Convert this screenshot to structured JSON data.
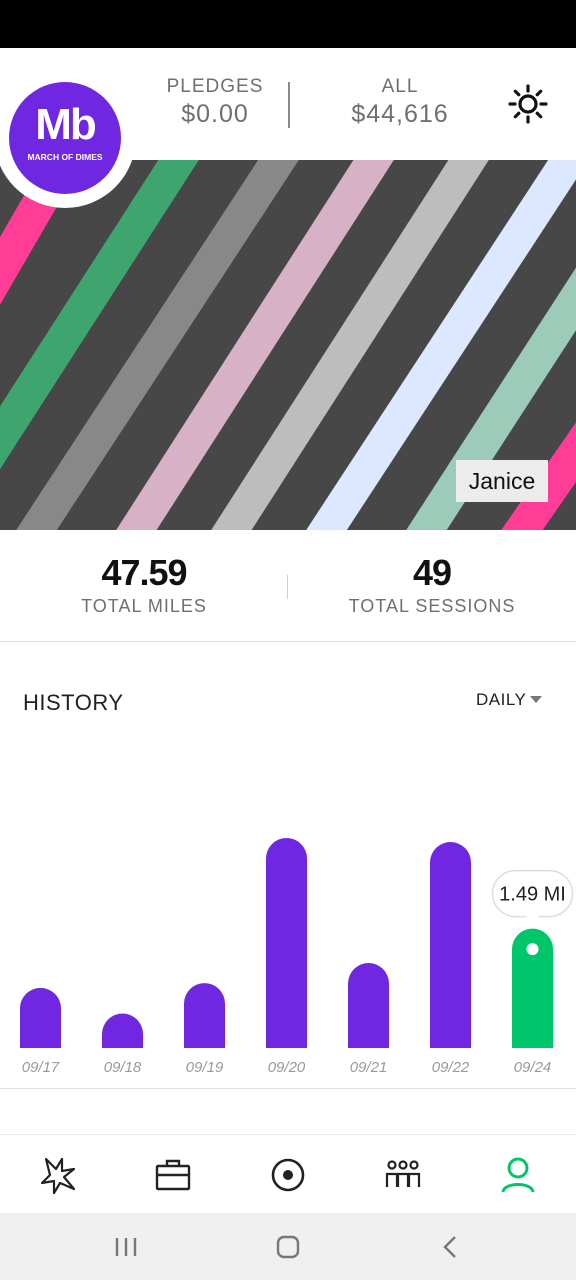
{
  "header": {
    "pledges_label": "PLEDGES",
    "pledges_value": "$0.00",
    "all_label": "ALL",
    "all_value": "$44,616",
    "settings_icon": "gear-icon"
  },
  "logo": {
    "mark": "Mb",
    "text": "MARCH OF DIMES",
    "color": "#7027e2"
  },
  "banner": {
    "name": "Janice"
  },
  "totals": {
    "miles_value": "47.59",
    "miles_label": "TOTAL MILES",
    "sessions_value": "49",
    "sessions_label": "TOTAL SESSIONS"
  },
  "history": {
    "title": "HISTORY",
    "period": "DAILY"
  },
  "chart_data": {
    "type": "bar",
    "categories": [
      "09/17",
      "09/18",
      "09/19",
      "09/20",
      "09/21",
      "09/22",
      "09/24"
    ],
    "values": [
      0.75,
      0.43,
      0.81,
      2.62,
      1.06,
      2.57,
      1.49
    ],
    "selected_index": 6,
    "tooltip": "1.49 MI",
    "colors": {
      "bar": "#7027e2",
      "selected": "#00c66b"
    }
  },
  "tabs": [
    {
      "name": "tab-activity",
      "icon": "burst-icon"
    },
    {
      "name": "tab-causes",
      "icon": "briefcase-icon"
    },
    {
      "name": "tab-record",
      "icon": "record-icon"
    },
    {
      "name": "tab-teams",
      "icon": "group-icon"
    },
    {
      "name": "tab-profile",
      "icon": "profile-icon",
      "active": true
    }
  ],
  "colors": {
    "accent": "#00c66b",
    "brand": "#7027e2"
  }
}
